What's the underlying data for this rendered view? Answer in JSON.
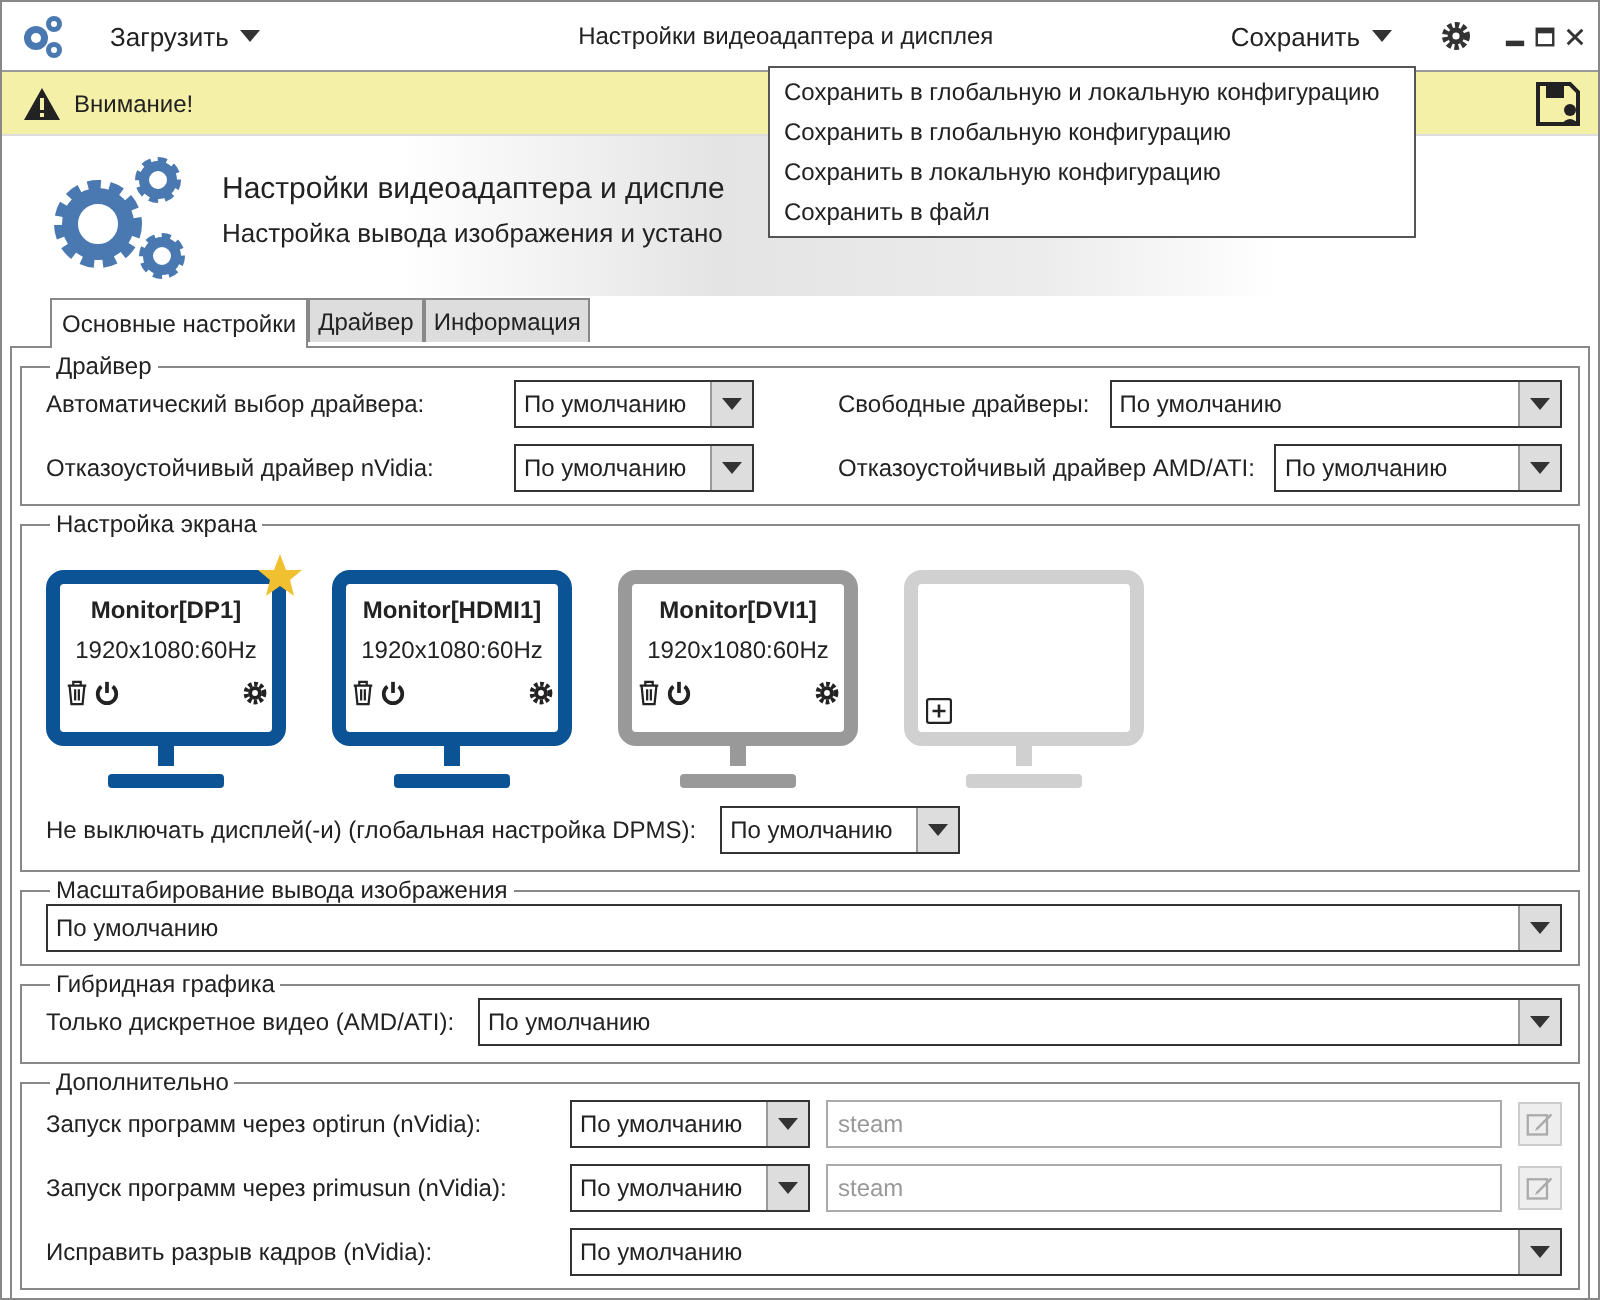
{
  "titlebar": {
    "load_menu": "Загрузить",
    "title": "Настройки видеоадаптера и дисплея",
    "save_menu": "Сохранить"
  },
  "save_dropdown": {
    "items": [
      "Сохранить в глобальную и локальную конфигурацию",
      "Сохранить в глобальную конфигурацию",
      "Сохранить в локальную конфигурацию",
      "Сохранить в файл"
    ]
  },
  "warning": {
    "text": "Внимание!"
  },
  "header": {
    "title": "Настройки видеоадаптера и диспле",
    "subtitle": "Настройка вывода изображения и устано"
  },
  "tabs": [
    {
      "label": "Основные настройки",
      "selected": true
    },
    {
      "label": "Драйвер",
      "selected": false
    },
    {
      "label": "Информация",
      "selected": false
    }
  ],
  "driver": {
    "legend": "Драйвер",
    "fields": [
      {
        "label": "Автоматический выбор драйвера:",
        "value": "По умолчанию"
      },
      {
        "label": "Свободные драйверы:",
        "value": "По умолчанию"
      },
      {
        "label": "Отказоустойчивый драйвер nVidia:",
        "value": "По умолчанию"
      },
      {
        "label": "Отказоустойчивый драйвер AMD/ATI:",
        "value": "По умолчанию"
      }
    ]
  },
  "screen": {
    "legend": "Настройка экрана",
    "monitors": [
      {
        "kind": "monitor",
        "name": "Monitor[DP1]",
        "mode": "1920x1080:60Hz",
        "enabled": true,
        "primary": true
      },
      {
        "kind": "monitor",
        "name": "Monitor[HDMI1]",
        "mode": "1920x1080:60Hz",
        "enabled": true,
        "primary": false
      },
      {
        "kind": "monitor",
        "name": "Monitor[DVI1]",
        "mode": "1920x1080:60Hz",
        "enabled": false,
        "primary": false
      },
      {
        "kind": "add"
      }
    ],
    "dpms": {
      "label": "Не выключать дисплей(-и) (глобальная настройка DPMS):",
      "value": "По умолчанию"
    }
  },
  "scaling": {
    "legend": "Масштабирование вывода изображения",
    "value": "По умолчанию"
  },
  "hybrid": {
    "legend": "Гибридная графика",
    "label": "Только дискретное видео (AMD/ATI):",
    "value": "По умолчанию"
  },
  "extra": {
    "legend": "Дополнительно",
    "rows": [
      {
        "kind": "program",
        "label": "Запуск программ через optirun (nVidia):",
        "value": "По умолчанию",
        "placeholder": "steam"
      },
      {
        "kind": "program",
        "label": "Запуск программ через primusun (nVidia):",
        "value": "По умолчанию",
        "placeholder": "steam"
      },
      {
        "kind": "select",
        "label": "Исправить разрыв кадров (nVidia):",
        "value": "По умолчанию"
      }
    ]
  }
}
